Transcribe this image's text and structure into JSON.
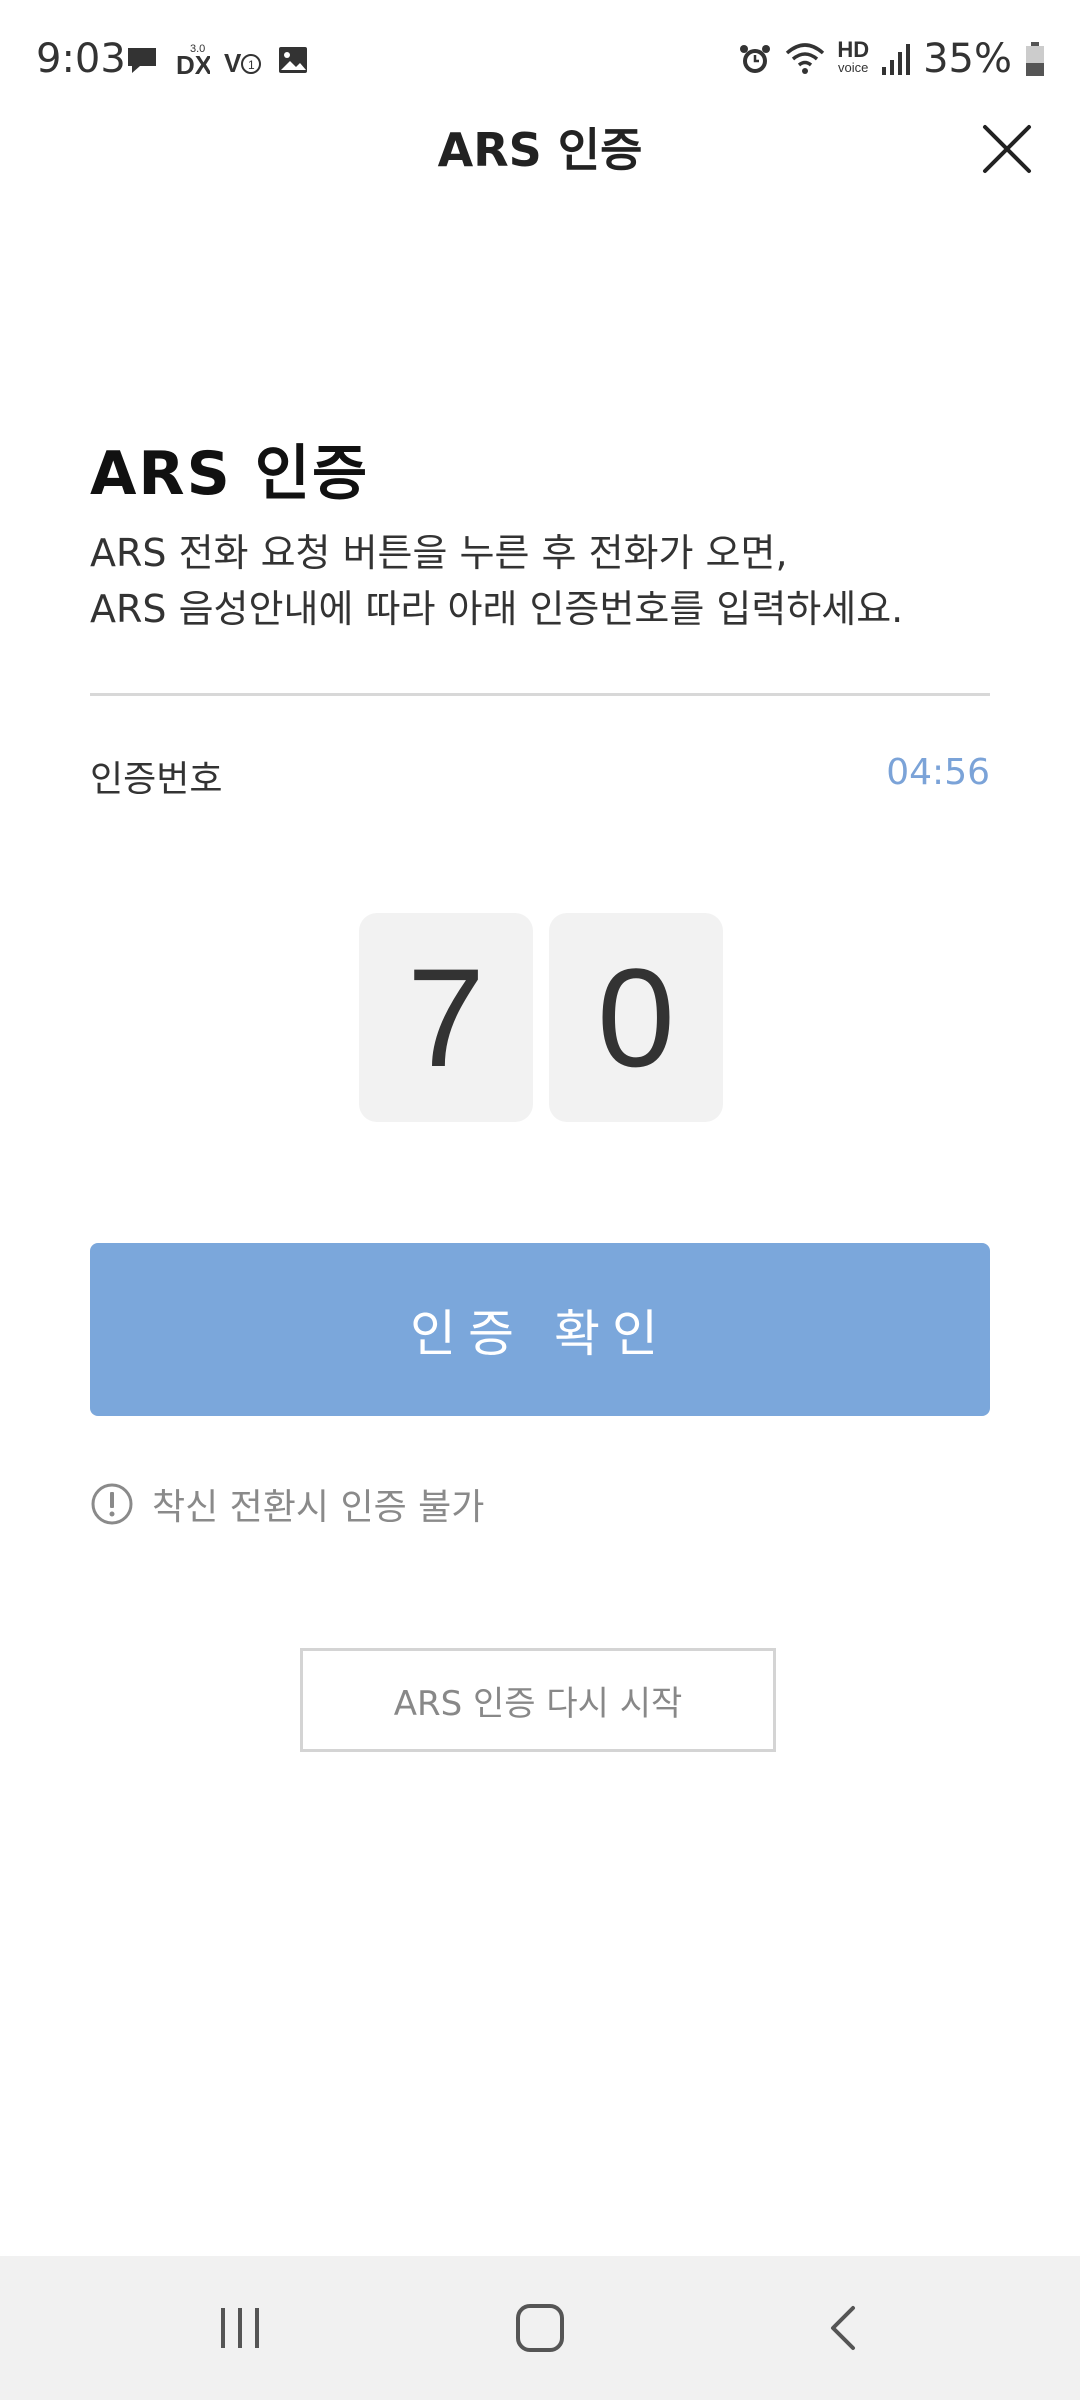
{
  "status_bar": {
    "time": "9:03",
    "battery": "35%",
    "hd_voice_top": "HD",
    "hd_voice_bottom": "voice"
  },
  "header": {
    "title": "ARS 인증",
    "close_icon": "close-icon"
  },
  "content": {
    "title": "ARS 인증",
    "description_line1": "ARS 전화 요청 버튼을 누른 후 전화가 오면,",
    "description_line2": "ARS 음성안내에 따라 아래 인증번호를 입력하세요.",
    "code_label": "인증번호",
    "timer": "04:56",
    "code_digits": [
      "7",
      "0"
    ]
  },
  "actions": {
    "confirm_label": "인증 확인",
    "notice_text": "착신 전환시 인증 불가",
    "restart_label": "ARS 인증 다시 시작"
  },
  "colors": {
    "accent": "#7ba7db",
    "timer": "#7ba3d8",
    "code_box_bg": "#f2f2f2",
    "navbar_bg": "#f1f1f1"
  },
  "nav_icons": [
    "recent-apps-icon",
    "home-icon",
    "back-icon"
  ]
}
